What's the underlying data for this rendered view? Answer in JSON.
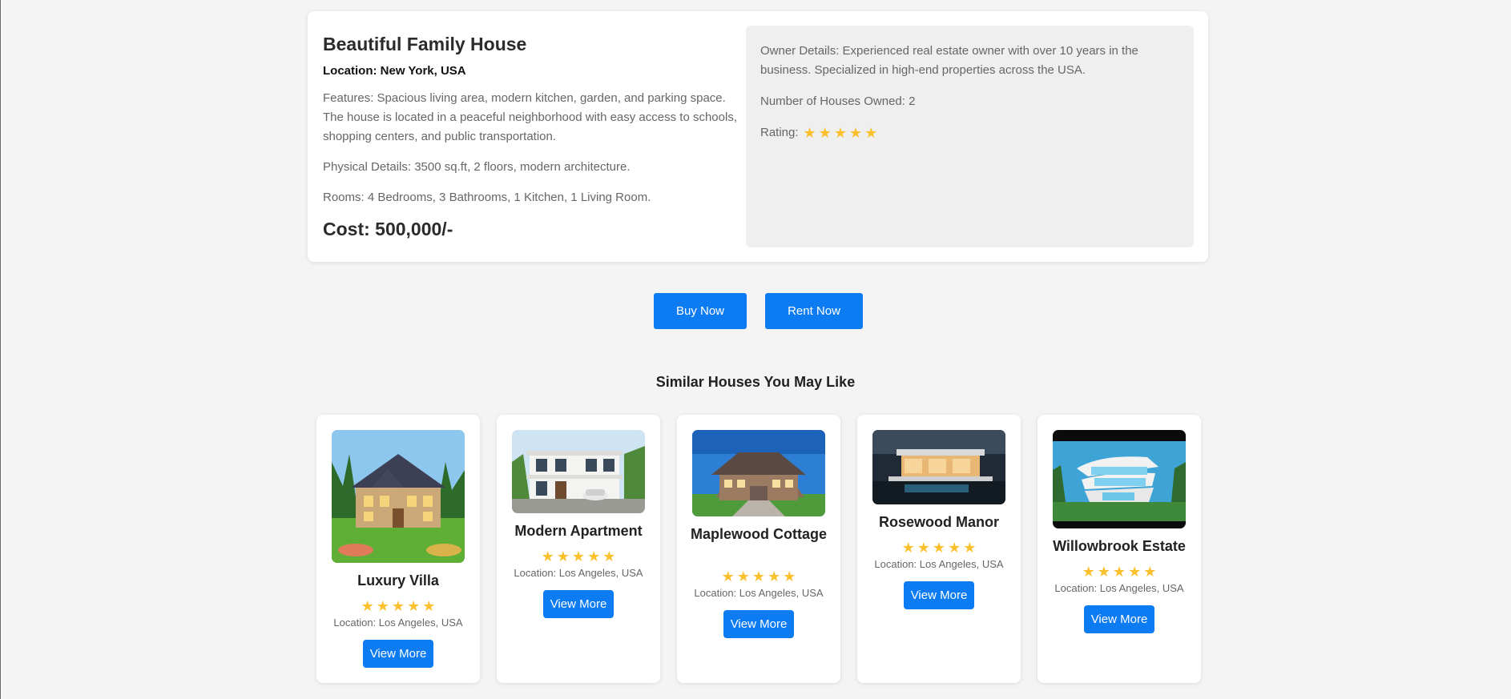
{
  "property": {
    "title": "Beautiful Family House",
    "location": "Location: New York, USA",
    "features": "Features: Spacious living area, modern kitchen, garden, and parking space. The house is located in a peaceful neighborhood with easy access to schools, shopping centers, and public transportation.",
    "physical": "Physical Details: 3500 sq.ft, 2 floors, modern architecture.",
    "rooms": "Rooms: 4 Bedrooms, 3 Bathrooms, 1 Kitchen, 1 Living Room.",
    "cost": "Cost: 500,000/-"
  },
  "owner": {
    "details": "Owner Details: Experienced real estate owner with over 10 years in the business. Specialized in high-end properties across the USA.",
    "houses_owned": "Number of Houses Owned: 2",
    "rating_label": "Rating:",
    "rating_stars": 5
  },
  "actions": {
    "buy_label": "Buy Now",
    "rent_label": "Rent Now"
  },
  "similar": {
    "heading": "Similar Houses You May Like",
    "view_label": "View More",
    "houses": [
      {
        "name": "Luxury Villa",
        "location": "Location: Los Angeles, USA",
        "stars": 5
      },
      {
        "name": "Modern Apartment",
        "location": "Location: Los Angeles, USA",
        "stars": 5
      },
      {
        "name": "Maplewood Cottage",
        "location": "Location: Los Angeles, USA",
        "stars": 5
      },
      {
        "name": "Rosewood Manor",
        "location": "Location: Los Angeles, USA",
        "stars": 5
      },
      {
        "name": "Willowbrook Estate",
        "location": "Location: Los Angeles, USA",
        "stars": 5
      }
    ]
  },
  "colors": {
    "accent": "#0d7bf2",
    "star": "#fbc02d"
  },
  "icons": {
    "star": "star-icon"
  }
}
